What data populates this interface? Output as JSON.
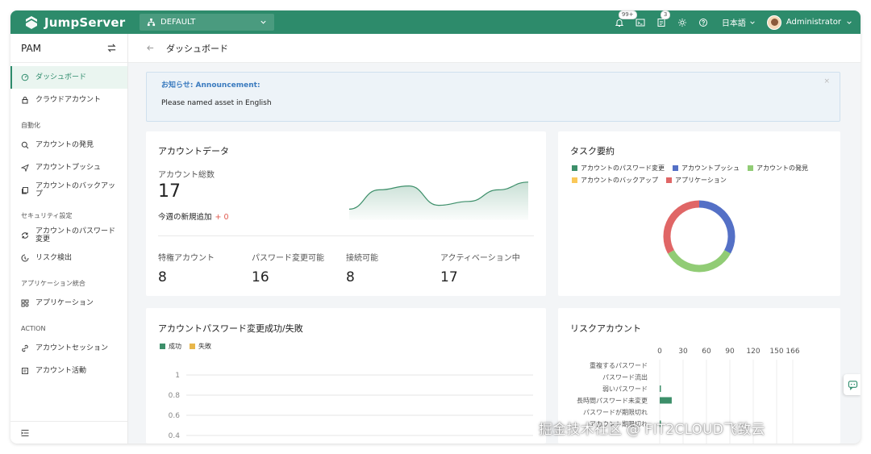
{
  "app": {
    "brand": "JumpServer",
    "org_selector": "DEFAULT",
    "notifications_badge": "99+",
    "tickets_badge": "3",
    "language": "日本語",
    "user_name": "Administrator"
  },
  "sidebar": {
    "title": "PAM",
    "items": [
      {
        "type": "item",
        "label": "ダッシュボード",
        "icon": "dashboard-icon",
        "active": true
      },
      {
        "type": "item",
        "label": "クラウドアカウント",
        "icon": "lock-icon"
      },
      {
        "type": "section",
        "label": "自動化"
      },
      {
        "type": "item",
        "label": "アカウントの発見",
        "icon": "search-icon"
      },
      {
        "type": "item",
        "label": "アカウントプッシュ",
        "icon": "send-icon"
      },
      {
        "type": "item",
        "label": "アカウントのバックアップ",
        "icon": "backup-icon"
      },
      {
        "type": "section",
        "label": "セキュリティ設定"
      },
      {
        "type": "item",
        "label": "アカウントのパスワード変更",
        "icon": "key-change-icon"
      },
      {
        "type": "item",
        "label": "リスク検出",
        "icon": "risk-icon"
      },
      {
        "type": "section",
        "label": "アプリケーション統合"
      },
      {
        "type": "item",
        "label": "アプリケーション",
        "icon": "apps-icon"
      },
      {
        "type": "section",
        "label": "ACTION"
      },
      {
        "type": "item",
        "label": "アカウントセッション",
        "icon": "link-icon"
      },
      {
        "type": "item",
        "label": "アカウント活動",
        "icon": "activity-icon"
      }
    ]
  },
  "breadcrumb": {
    "title": "ダッシュボード"
  },
  "announcement": {
    "title": "お知らせ: Announcement:",
    "body": "Please named asset in English",
    "close": "×"
  },
  "account_data": {
    "title": "アカウントデータ",
    "total_label": "アカウント総数",
    "total_value": "17",
    "new_label": "今週の新規追加",
    "new_value": "+ 0",
    "stats": [
      {
        "label": "特権アカウント",
        "value": "8"
      },
      {
        "label": "パスワード変更可能",
        "value": "16"
      },
      {
        "label": "接続可能",
        "value": "8"
      },
      {
        "label": "アクティベーション中",
        "value": "17"
      }
    ]
  },
  "task_summary": {
    "title": "タスク要約",
    "legend": [
      {
        "label": "アカウントのパスワード変更",
        "color": "#3d8f6a"
      },
      {
        "label": "アカウントプッシュ",
        "color": "#5470c6"
      },
      {
        "label": "アカウントの発見",
        "color": "#91cc75"
      },
      {
        "label": "アカウントのバックアップ",
        "color": "#fac858"
      },
      {
        "label": "アプリケーション",
        "color": "#e06666"
      }
    ]
  },
  "pw_change": {
    "title": "アカウントパスワード変更成功/失敗",
    "legend": [
      {
        "label": "成功",
        "color": "#3d8f6a"
      },
      {
        "label": "失敗",
        "color": "#e8b64a"
      }
    ]
  },
  "risk_accounts": {
    "title": "リスクアカウント"
  },
  "watermark": "掘金技术社区 @ FIT2CLOUD飞致云",
  "chart_data": [
    {
      "type": "area",
      "x": [
        0,
        1,
        2,
        3,
        4,
        5,
        6
      ],
      "values": [
        2,
        7,
        8,
        3,
        4,
        7,
        9
      ],
      "ylim": [
        0,
        10
      ],
      "color": "#3d8f6a"
    },
    {
      "type": "pie",
      "variant": "donut",
      "labels": [
        "アカウントプッシュ",
        "アカウントの発見",
        "アプリケーション"
      ],
      "values": [
        33,
        34,
        33
      ],
      "colors": [
        "#5470c6",
        "#91cc75",
        "#e06666"
      ]
    },
    {
      "type": "line",
      "title": "アカウントパスワード変更成功/失敗",
      "series": [
        {
          "name": "成功",
          "values": []
        },
        {
          "name": "失敗",
          "values": []
        }
      ],
      "y_ticks": [
        "1",
        "0.8",
        "0.6",
        "0.4"
      ],
      "ylim": [
        0,
        1
      ]
    },
    {
      "type": "bar",
      "orientation": "horizontal",
      "categories": [
        "重複するパスワード",
        "パスワード流出",
        "弱いパスワード",
        "長時間パスワード未変更",
        "パスワードが期限切れ",
        "アカウント期限切れ"
      ],
      "values": [
        0,
        0,
        1,
        15,
        0,
        1
      ],
      "x_ticks": [
        "0",
        "30",
        "60",
        "90",
        "120",
        "150",
        "166"
      ],
      "xlim": [
        0,
        166
      ],
      "color": "#3d8f6a"
    }
  ]
}
